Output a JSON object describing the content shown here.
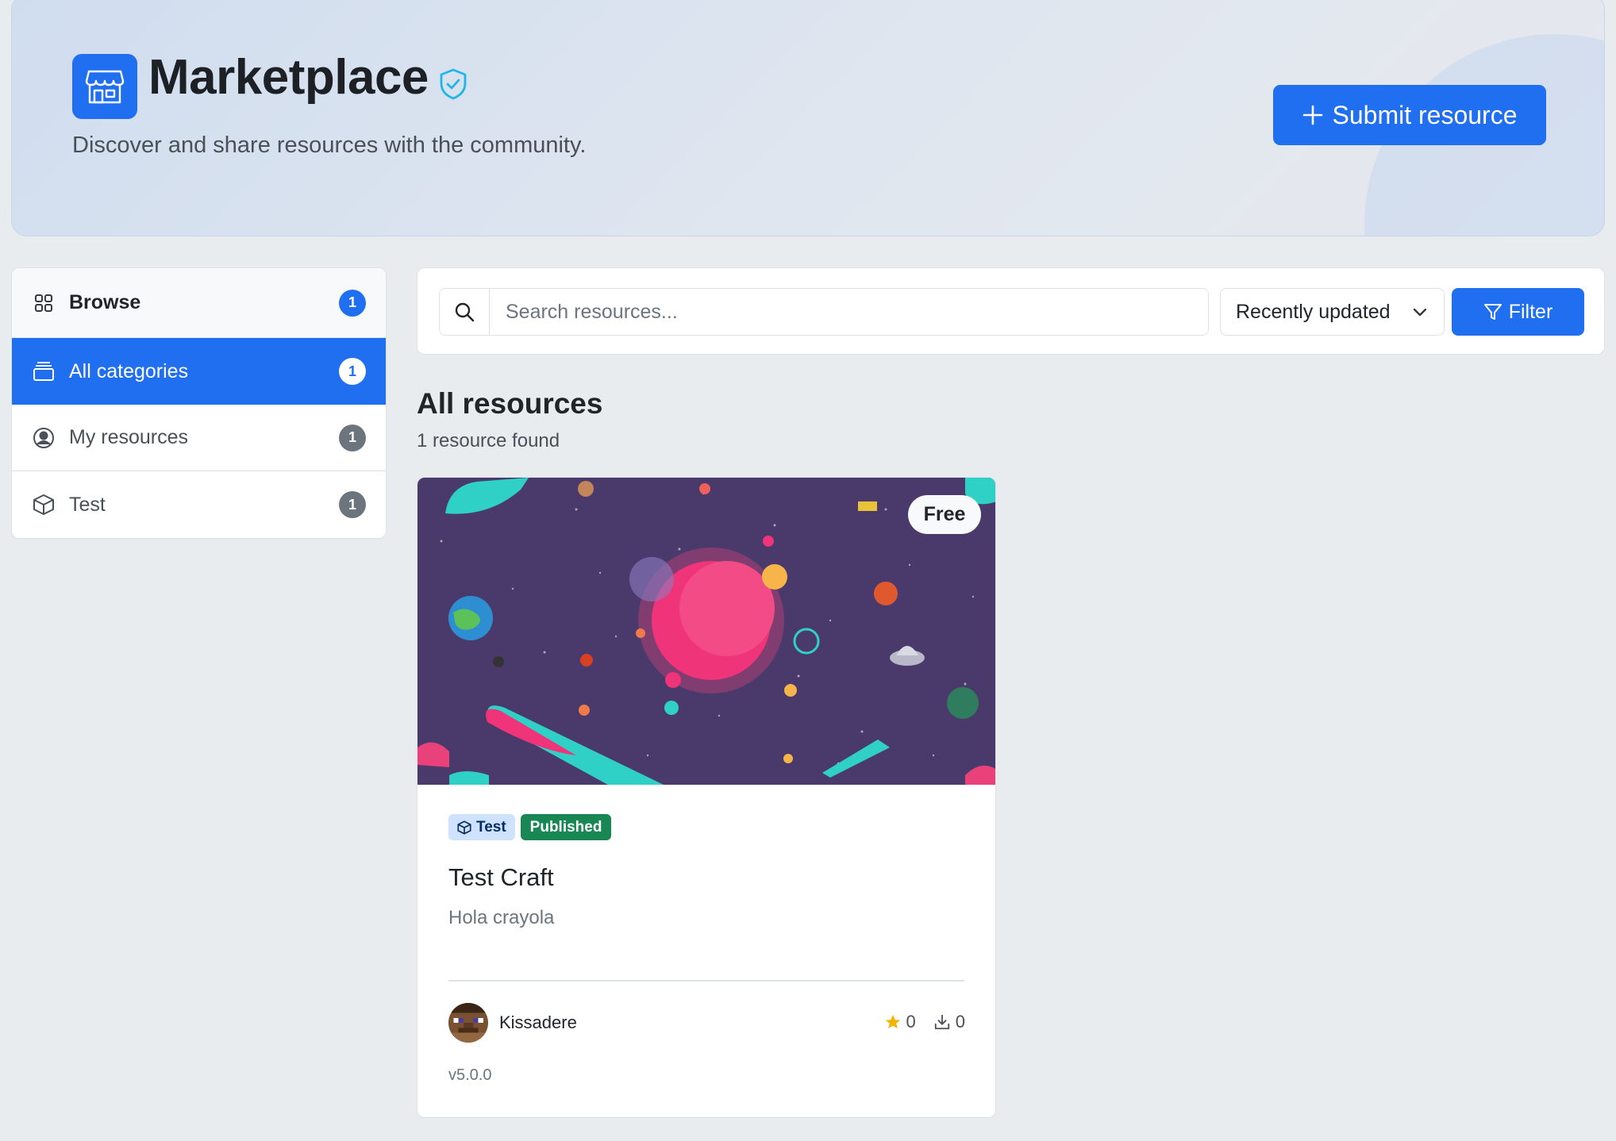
{
  "hero": {
    "title": "Marketplace",
    "subtitle": "Discover and share resources with the community.",
    "submit_label": "Submit resource",
    "logo_icon": "storefront-icon",
    "verified_icon": "shield-check-icon"
  },
  "sidebar": {
    "items": [
      {
        "label": "Browse",
        "count": "1",
        "icon": "grid-icon"
      },
      {
        "label": "All categories",
        "count": "1",
        "icon": "layers-icon"
      },
      {
        "label": "My resources",
        "count": "1",
        "icon": "user-circle-icon"
      },
      {
        "label": "Test",
        "count": "1",
        "icon": "box-icon"
      }
    ]
  },
  "search": {
    "placeholder": "Search resources...",
    "value": "",
    "sort_selected": "Recently updated",
    "filter_label": "Filter"
  },
  "results": {
    "title": "All resources",
    "count_text": "1 resource found"
  },
  "cards": [
    {
      "price_badge": "Free",
      "category_tag": "Test",
      "status_tag": "Published",
      "title": "Test Craft",
      "description": "Hola crayola",
      "author": "Kissadere",
      "stars": "0",
      "downloads": "0",
      "version": "v5.0.0"
    }
  ],
  "colors": {
    "accent": "#1f6ff0",
    "background": "#e9ecef",
    "published": "#198754",
    "star": "#f5b301"
  }
}
